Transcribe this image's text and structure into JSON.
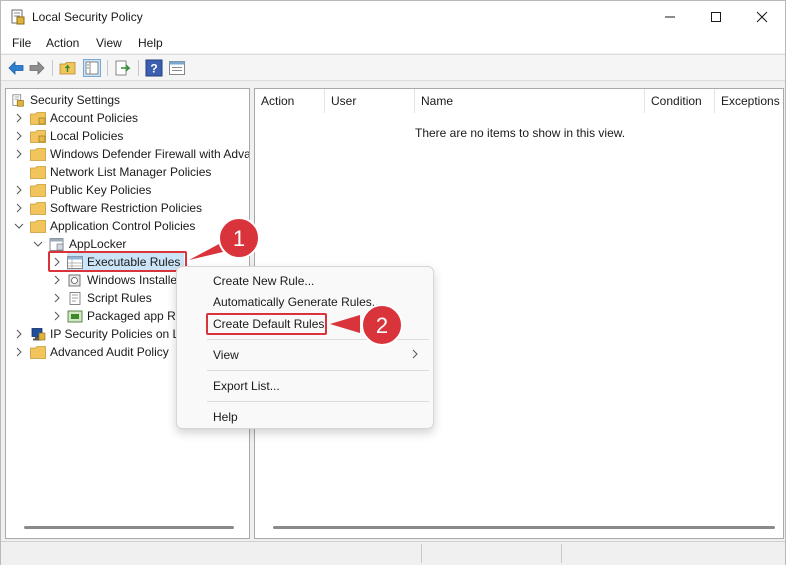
{
  "window": {
    "title": "Local Security Policy"
  },
  "menubar": {
    "items": [
      "File",
      "Action",
      "View",
      "Help"
    ]
  },
  "tree": {
    "root": "Security Settings",
    "items": [
      {
        "label": "Account Policies"
      },
      {
        "label": "Local Policies"
      },
      {
        "label": "Windows Defender Firewall with Adva"
      },
      {
        "label": "Network List Manager Policies"
      },
      {
        "label": "Public Key Policies"
      },
      {
        "label": "Software Restriction Policies"
      },
      {
        "label": "Application Control Policies"
      },
      {
        "label": "AppLocker"
      },
      {
        "label": "Executable Rules"
      },
      {
        "label": "Windows Installe"
      },
      {
        "label": "Script Rules"
      },
      {
        "label": "Packaged app R"
      },
      {
        "label": "IP Security Policies on L"
      },
      {
        "label": "Advanced Audit Policy"
      }
    ]
  },
  "list": {
    "columns": [
      "Action",
      "User",
      "Name",
      "Condition",
      "Exceptions"
    ],
    "empty_message": "There are no items to show in this view."
  },
  "context_menu": {
    "items": [
      "Create New Rule...",
      "Automatically Generate Rules...",
      "Create Default Rules",
      "View",
      "Export List...",
      "Help"
    ]
  },
  "callouts": {
    "first": "1",
    "second": "2"
  },
  "colors": {
    "accent_red": "#d9343b",
    "selection": "#cce4f7",
    "folder": "#f2c55c"
  },
  "icons": {
    "minimize": "minimize-icon",
    "maximize": "maximize-icon",
    "close": "close-icon",
    "back": "back-arrow-icon",
    "forward": "forward-arrow-icon",
    "up_folder": "up-folder-icon",
    "show_hide_tree": "show-hide-tree-icon",
    "export": "export-list-icon",
    "help": "help-icon",
    "properties": "properties-icon"
  }
}
